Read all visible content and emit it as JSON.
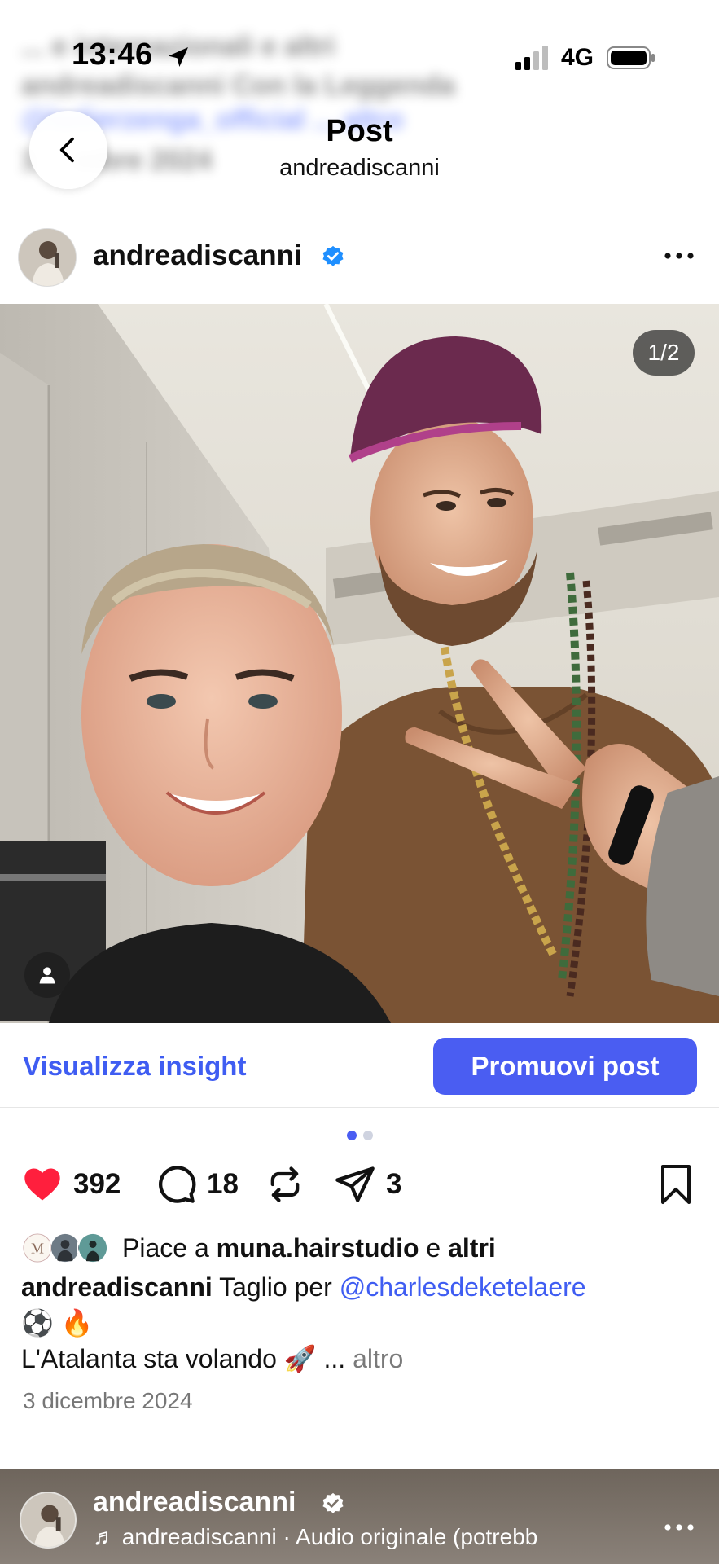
{
  "status_bar": {
    "time": "13:46",
    "network": "4G"
  },
  "background_ghost": {
    "line1": "... e internazionali e altri",
    "line2": "andreadiscanni Con la Leggenda",
    "line3": "@ladierzenga_official ... altro",
    "line4": "1 ... mbre 2024"
  },
  "nav": {
    "title": "Post",
    "subtitle": "andreadiscanni"
  },
  "post": {
    "username": "andreadiscanni",
    "image_counter": "1/2",
    "insight_link": "Visualizza insight",
    "promote_button": "Promuovi post",
    "likes_count": "392",
    "comments_count": "18",
    "shares_count": "3",
    "likes_prefix": "Piace a",
    "likes_user": "muna.hairstudio",
    "likes_connector": "e",
    "likes_others": "altri",
    "caption_user": "andreadiscanni",
    "caption_text": "Taglio per",
    "caption_mention": "@charlesdeketelaere",
    "caption_emojis": "⚽️ 🔥",
    "caption_line2": "L'Atalanta sta volando 🚀 ...",
    "caption_more": "altro",
    "date": "3 dicembre 2024"
  },
  "bottom_bar": {
    "username": "andreadiscanni",
    "audio": "♬ andreadiscanni · Audio originale  (potrebb"
  },
  "colors": {
    "accent": "#4a5df2",
    "like": "#ff1f3d",
    "verified": "#1f8fff"
  }
}
